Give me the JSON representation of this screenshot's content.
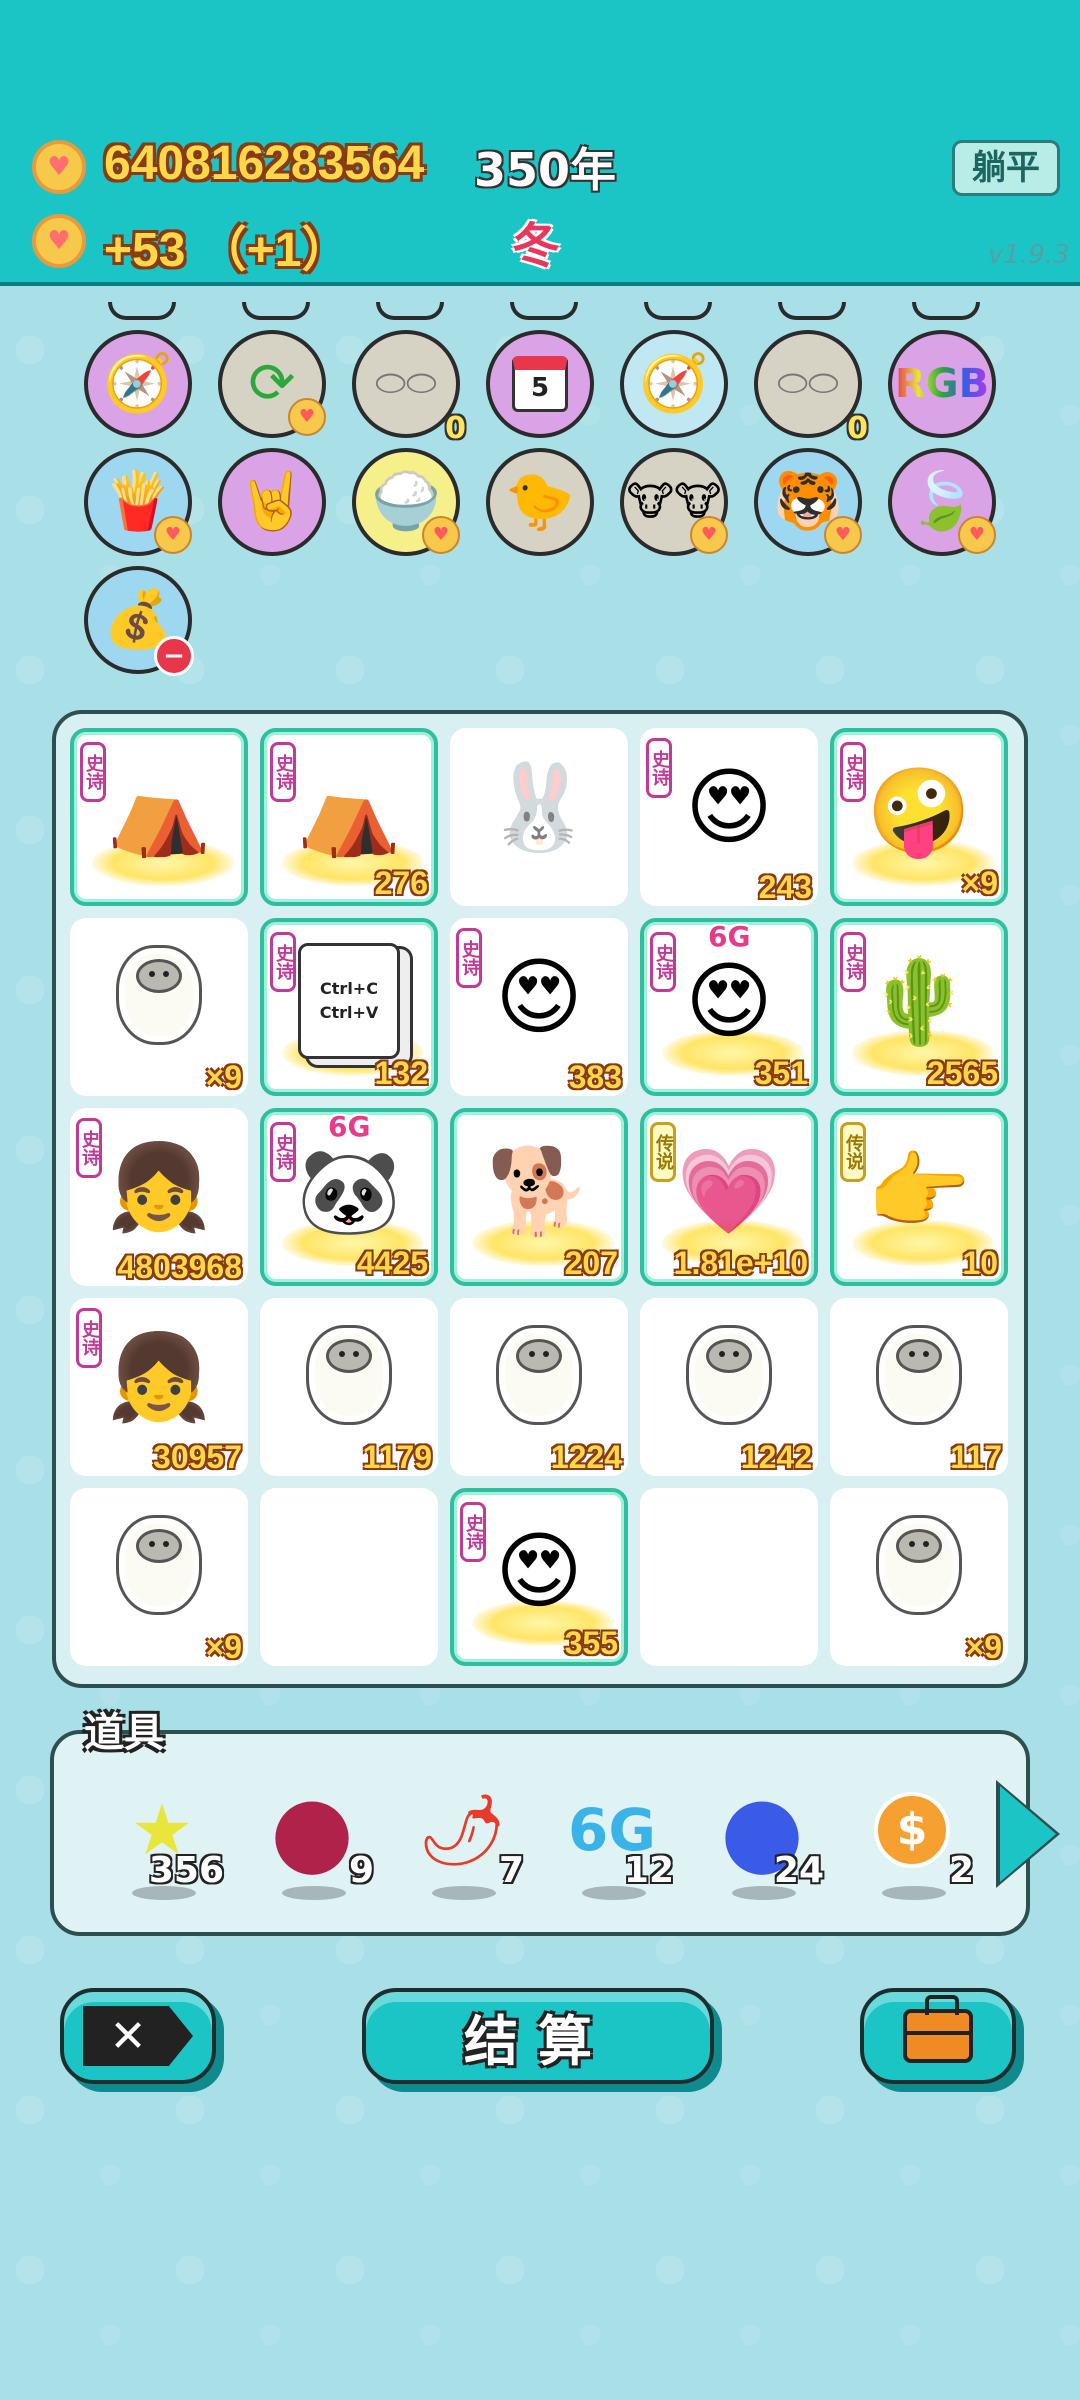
{
  "header": {
    "gold": "640816283564",
    "income": "+53 （+1）",
    "year": "350年",
    "season": "冬",
    "flat_button": "躺平",
    "version": "v1.9.3"
  },
  "skills_row1": [
    "compass-icon",
    "refresh-icon",
    "egg-tray-icon",
    "calendar-icon",
    "compass-icon",
    "egg-tray-icon",
    "rgb-icon"
  ],
  "skills_row2": [
    "fries-icon",
    "rock-hand-icon",
    "rice-bowl-icon",
    "chick-icon",
    "cows-icon",
    "tiger-icon",
    "leaf-icon"
  ],
  "skills_row3": [
    "money-bag-icon"
  ],
  "calendar_day": "5",
  "rgb_label": "RGB",
  "zero_badge": "0",
  "grid": {
    "cells": [
      {
        "name": "rabbit-house",
        "glyph": "⛺",
        "tag": "史诗",
        "count": "",
        "rare": true
      },
      {
        "name": "rabbit-house",
        "glyph": "⛺",
        "tag": "史诗",
        "count": "276",
        "rare": true
      },
      {
        "name": "rabbit",
        "glyph": "🐰",
        "tag": "",
        "count": "",
        "rare": false
      },
      {
        "name": "bald-man",
        "glyph": "😍",
        "tag": "史诗",
        "count": "243",
        "rare": false
      },
      {
        "name": "silver-hair-guy",
        "glyph": "🤪",
        "tag": "史诗",
        "count": "×9",
        "rare": true
      },
      {
        "name": "sheep",
        "glyph": "sheep",
        "tag": "",
        "count": "×9",
        "rare": false
      },
      {
        "name": "ctrl-c-ctrl-v",
        "glyph": "📄",
        "tag": "史诗",
        "count": "132",
        "rare": true
      },
      {
        "name": "bald-man",
        "glyph": "😍",
        "tag": "史诗",
        "count": "383",
        "rare": false
      },
      {
        "name": "6g-king",
        "glyph": "😍",
        "tag": "史诗",
        "count": "351",
        "rare": true
      },
      {
        "name": "heart-cactus",
        "glyph": "🌵",
        "tag": "史诗",
        "count": "2565",
        "rare": true
      },
      {
        "name": "heart-girl",
        "glyph": "👧",
        "tag": "史诗",
        "count": "4803968",
        "rare": false
      },
      {
        "name": "6g-panda",
        "glyph": "🐼",
        "tag": "史诗",
        "count": "4425",
        "rare": true
      },
      {
        "name": "husky-dog",
        "glyph": "🐕",
        "tag": "",
        "count": "207",
        "rare": true
      },
      {
        "name": "heart-king",
        "glyph": "💗",
        "tag": "传说",
        "count": "1.81e+10",
        "rare": true
      },
      {
        "name": "pointing-hand",
        "glyph": "👉",
        "tag": "传说",
        "count": "10",
        "rare": true
      },
      {
        "name": "heart-girl",
        "glyph": "👧",
        "tag": "史诗",
        "count": "30957",
        "rare": false
      },
      {
        "name": "sheep",
        "glyph": "sheep",
        "tag": "",
        "count": "1179",
        "rare": false
      },
      {
        "name": "sheep",
        "glyph": "sheep",
        "tag": "",
        "count": "1224",
        "rare": false
      },
      {
        "name": "sheep",
        "glyph": "sheep",
        "tag": "",
        "count": "1242",
        "rare": false
      },
      {
        "name": "sheep",
        "glyph": "sheep",
        "tag": "",
        "count": "117",
        "rare": false
      },
      {
        "name": "sheep",
        "glyph": "sheep",
        "tag": "",
        "count": "×9",
        "rare": false
      },
      {
        "name": "empty",
        "glyph": "",
        "tag": "",
        "count": "",
        "rare": false
      },
      {
        "name": "crowned-bald-man",
        "glyph": "😍",
        "tag": "史诗",
        "count": "355",
        "rare": true
      },
      {
        "name": "empty",
        "glyph": "",
        "tag": "",
        "count": "",
        "rare": false
      },
      {
        "name": "sheep",
        "glyph": "sheep",
        "tag": "",
        "count": "×9",
        "rare": false
      }
    ]
  },
  "badge_6g": "6G",
  "ctrl_lines": [
    "Ctrl+C",
    "Ctrl+V"
  ],
  "items_panel": {
    "title": "道具",
    "items": [
      {
        "name": "star",
        "glyph": "★",
        "color": "#e8e63a",
        "qty": "356"
      },
      {
        "name": "lychee",
        "glyph": "●",
        "color": "#b0224a",
        "qty": "9"
      },
      {
        "name": "chili",
        "glyph": "🌶",
        "color": "#e83a2a",
        "qty": "7"
      },
      {
        "name": "6g",
        "glyph": "6G",
        "color": "#3ab4e8",
        "qty": "12"
      },
      {
        "name": "blueberry",
        "glyph": "●",
        "color": "#3a5ae8",
        "qty": "24"
      },
      {
        "name": "coin",
        "glyph": "$",
        "color": "#f08a22",
        "qty": "2"
      }
    ]
  },
  "buttons": {
    "settle": "结算",
    "exit_icon": "✕"
  }
}
